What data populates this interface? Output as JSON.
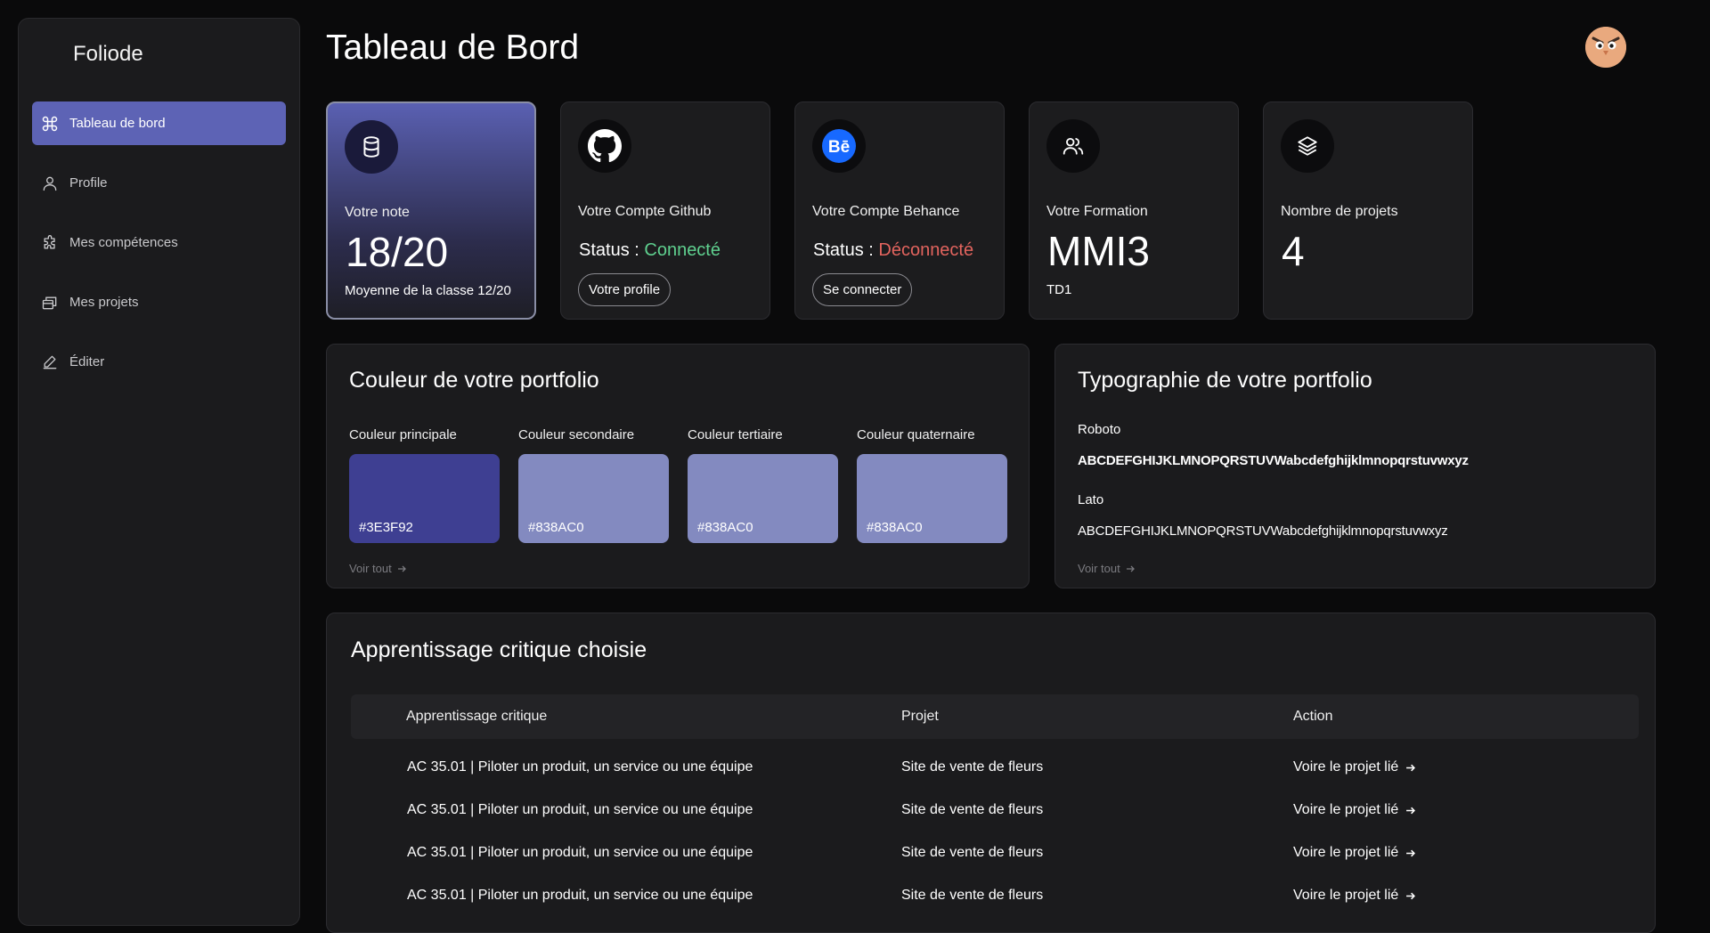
{
  "app": {
    "brand": "Foliode",
    "page_title": "Tableau de Bord"
  },
  "sidebar": {
    "items": [
      {
        "label": "Tableau de bord",
        "icon": "command-icon"
      },
      {
        "label": "Profile",
        "icon": "user-icon"
      },
      {
        "label": "Mes compétences",
        "icon": "puzzle-icon"
      },
      {
        "label": "Mes projets",
        "icon": "folders-icon"
      },
      {
        "label": "Éditer",
        "icon": "pencil-icon"
      }
    ]
  },
  "cards": {
    "note": {
      "label": "Votre note",
      "value": "18/20",
      "sub": "Moyenne de la classe 12/20",
      "icon": "database-icon"
    },
    "github": {
      "label": "Votre Compte Github",
      "status_prefix": "Status : ",
      "status": "Connecté",
      "button": "Votre profile",
      "icon": "github-icon"
    },
    "behance": {
      "label": "Votre Compte Behance",
      "status_prefix": "Status : ",
      "status": "Déconnecté",
      "button": "Se connecter",
      "icon": "behance-icon"
    },
    "formation": {
      "label": "Votre Formation",
      "value": "MMI3",
      "sub": "TD1",
      "icon": "users-icon"
    },
    "projects": {
      "label": "Nombre de projets",
      "value": "4",
      "icon": "layers-icon"
    }
  },
  "colors_panel": {
    "title": "Couleur de votre portfolio",
    "swatches": [
      {
        "label": "Couleur principale",
        "hex": "#3E3F92"
      },
      {
        "label": "Couleur secondaire",
        "hex": "#838AC0"
      },
      {
        "label": "Couleur tertiaire",
        "hex": "#838AC0"
      },
      {
        "label": "Couleur quaternaire",
        "hex": "#838AC0"
      }
    ],
    "see_all": "Voir tout"
  },
  "typo_panel": {
    "title": "Typographie de votre portfolio",
    "fonts": [
      {
        "name": "Roboto",
        "sample": "ABCDEFGHIJKLMNOPQRSTUVWabcdefghijklmnopqrstuvwxyz"
      },
      {
        "name": "Lato",
        "sample": "ABCDEFGHIJKLMNOPQRSTUVWabcdefghijklmnopqrstuvwxyz"
      }
    ],
    "see_all": "Voir tout"
  },
  "ac_panel": {
    "title": "Apprentissage critique choisie",
    "headers": [
      "Apprentissage critique",
      "Projet",
      "Action"
    ],
    "rows": [
      {
        "ac": "AC 35.01 | Piloter un produit, un service ou une équipe",
        "project": "Site de vente de fleurs",
        "action": "Voire le projet lié"
      },
      {
        "ac": "AC 35.01 | Piloter un produit, un service ou une équipe",
        "project": "Site de vente de fleurs",
        "action": "Voire le projet lié"
      },
      {
        "ac": "AC 35.01 | Piloter un produit, un service ou une équipe",
        "project": "Site de vente de fleurs",
        "action": "Voire le projet lié"
      },
      {
        "ac": "AC 35.01 | Piloter un produit, un service ou une équipe",
        "project": "Site de vente de fleurs",
        "action": "Voire le projet lié"
      }
    ]
  },
  "theme": {
    "accent": "#5d63b5",
    "connected_color": "#5fd08f",
    "disconnected_color": "#e2645e",
    "behance_blue": "#1769ff"
  }
}
